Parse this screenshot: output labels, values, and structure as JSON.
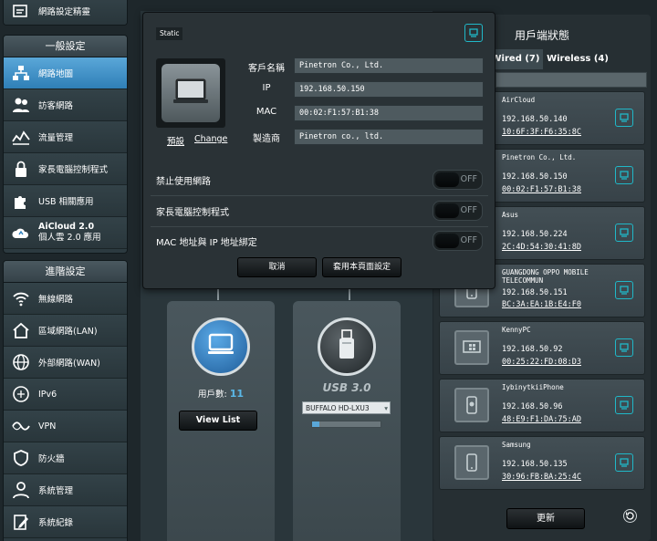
{
  "sidebar": {
    "top_item": "網路設定精靈",
    "general_header": "一般設定",
    "general_items": [
      {
        "icon": "network-map-icon",
        "label": "網路地圖",
        "active": true
      },
      {
        "icon": "guest-network-icon",
        "label": "訪客網路"
      },
      {
        "icon": "traffic-manager-icon",
        "label": "流量管理"
      },
      {
        "icon": "parental-control-icon",
        "label": "家長電腦控制程式"
      },
      {
        "icon": "usb-puzzle-icon",
        "label": "USB 相關應用"
      },
      {
        "icon": "aicloud-icon",
        "label": "AiCloud 2.0",
        "label2": "個人雲 2.0 應用"
      }
    ],
    "advanced_header": "進階設定",
    "advanced_items": [
      {
        "icon": "wireless-icon",
        "label": "無線網路"
      },
      {
        "icon": "lan-house-icon",
        "label": "區域網路(LAN)"
      },
      {
        "icon": "wan-globe-icon",
        "label": "外部網路(WAN)"
      },
      {
        "icon": "ipv6-icon",
        "label": "IPv6"
      },
      {
        "icon": "vpn-icon",
        "label": "VPN"
      },
      {
        "icon": "firewall-shield-icon",
        "label": "防火牆"
      },
      {
        "icon": "admin-user-icon",
        "label": "系統管理"
      },
      {
        "icon": "system-log-icon",
        "label": "系統紀錄"
      }
    ]
  },
  "main": {
    "clients_label": "用戶數:",
    "clients_count": "11",
    "view_list": "View List",
    "usb_label": "USB 3.0",
    "usb_device": "BUFFALO HD-LXU3",
    "usb_progress": 0.1
  },
  "modal": {
    "badge": "Static",
    "labels": {
      "name": "客戶名稱",
      "ip": "IP",
      "mac": "MAC",
      "vendor": "製造商"
    },
    "values": {
      "name": "Pinetron Co., Ltd.",
      "ip": "192.168.50.150",
      "mac": "00:02:F1:57:B1:38",
      "vendor": "Pinetron co., ltd."
    },
    "links": {
      "default": "預設",
      "change": "Change"
    },
    "toggles": [
      {
        "label": "禁止使用網路",
        "state": "OFF"
      },
      {
        "label": "家長電腦控制程式",
        "state": "OFF"
      },
      {
        "label": "MAC 地址與 IP 地址綁定",
        "state": "OFF"
      }
    ],
    "cancel": "取消",
    "apply": "套用本頁面設定"
  },
  "client_panel": {
    "title": "用戶端狀態",
    "tabs": [
      {
        "label": "Wired (7)",
        "selected": true
      },
      {
        "label": "Wireless (4)",
        "selected": false
      }
    ],
    "clients": [
      {
        "name": "AirCloud",
        "ip": "192.168.50.140",
        "mac": "10:6F:3F:F6:35:8C",
        "icon": "generic-device-icon"
      },
      {
        "name": "Pinetron Co., Ltd.",
        "ip": "192.168.50.150",
        "mac": "00:02:F1:57:B1:38",
        "icon": "generic-device-icon"
      },
      {
        "name": "Asus",
        "ip": "192.168.50.224",
        "mac": "2C:4D:54:30:41:8D",
        "icon": "generic-device-icon"
      },
      {
        "name": "GUANGDONG OPPO MOBILE TELECOMMUN",
        "ip": "192.168.50.151",
        "mac": "BC:3A:EA:1B:E4:F0",
        "icon": "phone-icon"
      },
      {
        "name": "KennyPC",
        "ip": "192.168.50.92",
        "mac": "00:25:22:FD:08:D3",
        "icon": "windows-pc-icon"
      },
      {
        "name": "IybinytkiiPhone",
        "ip": "192.168.50.96",
        "mac": "48:E9:F1:DA:75:AD",
        "icon": "apple-phone-icon"
      },
      {
        "name": "Samsung",
        "ip": "192.168.50.135",
        "mac": "30:96:FB:BA:25:4C",
        "icon": "phone-icon"
      }
    ],
    "refresh": "更新"
  },
  "colors": {
    "accent": "#20b8c8",
    "active_nav": "#3d8fc7",
    "highlight_count": "#5ab8e8"
  }
}
